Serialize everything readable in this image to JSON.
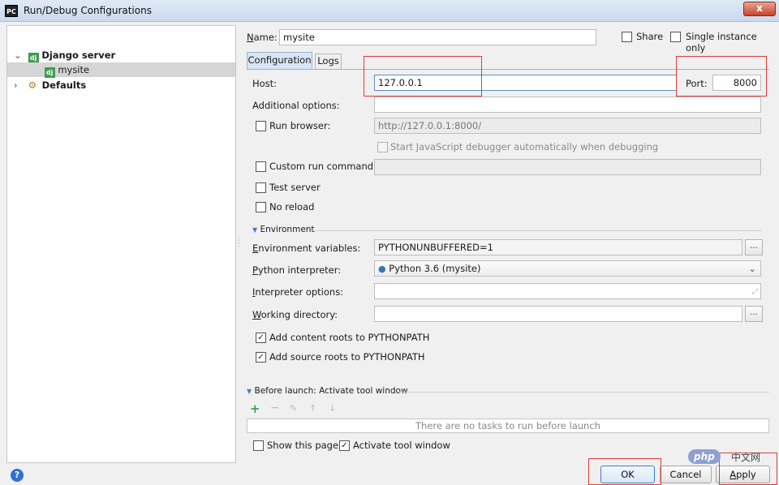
{
  "window": {
    "title": "Run/Debug Configurations",
    "close_label": "x",
    "app_icon": "PC"
  },
  "toolbar": {
    "icons": [
      "+",
      "−",
      "⧉",
      "⚙",
      "↑",
      "↓",
      "▬",
      "⇅"
    ]
  },
  "tree": {
    "group_label": "Django server",
    "child_label": "mysite",
    "defaults_label": "Defaults",
    "dj_badge": "dj"
  },
  "header": {
    "name_label": "Name:",
    "name_value": "mysite",
    "share_label": "Share",
    "single_instance_label": "Single instance only"
  },
  "tabs": [
    {
      "label": "Configuration"
    },
    {
      "label": "Logs"
    }
  ],
  "form": {
    "host_label": "Host:",
    "host_value": "127.0.0.1",
    "port_label": "Port:",
    "port_value": "8000",
    "additional_options_label": "Additional options:",
    "run_browser_label": "Run browser:",
    "run_browser_url": "http://127.0.0.1:8000/",
    "js_debugger_label": "Start JavaScript debugger automatically when debugging",
    "custom_run_label": "Custom run command:",
    "test_server_label": "Test server",
    "no_reload_label": "No reload",
    "environment_header": "Environment",
    "env_vars_label": "Environment variables:",
    "env_vars_value": "PYTHONUNBUFFERED=1",
    "interpreter_label": "Python interpreter:",
    "interpreter_value": "Python 3.6 (mysite)",
    "interpreter_options_label": "Interpreter options:",
    "working_dir_label": "Working directory:",
    "content_roots_label": "Add content roots to PYTHONPATH",
    "source_roots_label": "Add source roots to PYTHONPATH",
    "ellipsis": "..."
  },
  "before_launch": {
    "header": "Before launch: Activate tool window",
    "empty_text": "There are no tasks to run before launch",
    "show_page_label": "Show this page",
    "activate_tool_label": "Activate tool window"
  },
  "buttons": {
    "ok": "OK",
    "cancel": "Cancel",
    "apply": "Apply"
  },
  "help": "?",
  "watermark": {
    "php": "php",
    "site": "中文网"
  }
}
